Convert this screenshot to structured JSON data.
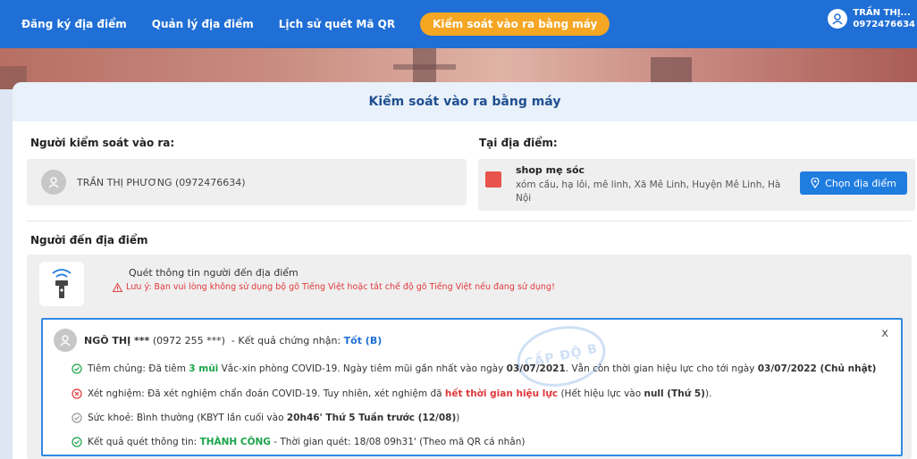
{
  "nav": {
    "items": [
      {
        "label": "Đăng ký địa điểm"
      },
      {
        "label": "Quản lý địa điểm"
      },
      {
        "label": "Lịch sử quét Mã QR"
      },
      {
        "label": "Kiểm soát vào ra bằng máy"
      }
    ],
    "active_index": 3,
    "user_name": "TRẦN THỊ...",
    "user_phone": "0972476634"
  },
  "page": {
    "title": "Kiểm soát vào ra bằng máy"
  },
  "controller": {
    "label": "Người kiểm soát vào ra:",
    "name": "TRẦN THỊ PHƯƠNG (0972476634)"
  },
  "location": {
    "label": "Tại địa điểm:",
    "name": "shop mẹ sóc",
    "address": "xóm cầu, hạ lôi, mê linh, Xã Mê Linh, Huyện Mê Linh, Hà Nội",
    "button": "Chọn địa điểm"
  },
  "visitor": {
    "label": "Người đến địa điểm",
    "scan_title": "Quét thông tin người đến địa điểm",
    "scan_warning": "Lưu ý: Bạn vui lòng không sử dụng bộ gõ Tiếng Việt hoặc tắt chế độ gõ Tiếng Việt nếu đang sử dụng!"
  },
  "result": {
    "name": "NGÔ THỊ ***",
    "phone": "(0972 255 ***)",
    "cert_label": "- Kết quả chứng nhận:",
    "cert_value": "Tốt (B)",
    "close": "x",
    "stamp": "CẤP ĐỘ B",
    "vaccine": {
      "a": "Tiêm chủng: Đã tiêm",
      "doses": "3 mũi",
      "b": "Vắc-xin phòng COVID-19. Ngày tiêm mũi gần nhất vào ngày",
      "last_date": "03/07/2021",
      "c": ". Vẫn còn thời gian hiệu lực cho tới ngày",
      "valid_until": "03/07/2022 (Chủ nhật)"
    },
    "test": {
      "a": "Xét nghiệm: Đã xét nghiệm chẩn đoán COVID-19. Tuy nhiên, xét nghiệm đã",
      "expired": "hết thời gian hiệu lực",
      "b": "(Hết hiệu lực vào",
      "null_val": "null (Thứ 5)",
      "c": ")."
    },
    "health": {
      "a": "Sức khoẻ: Bình thường (KBYT lần cuối vào",
      "last": "20h46' Thứ 5 Tuần trước (12/08)",
      "b": ")"
    },
    "scan": {
      "a": "Kết quả quét thông tin:",
      "status": "THÀNH CÔNG",
      "b": "- Thời gian quét: 18/08 09h31' (Theo mã QR cá nhân)"
    }
  }
}
